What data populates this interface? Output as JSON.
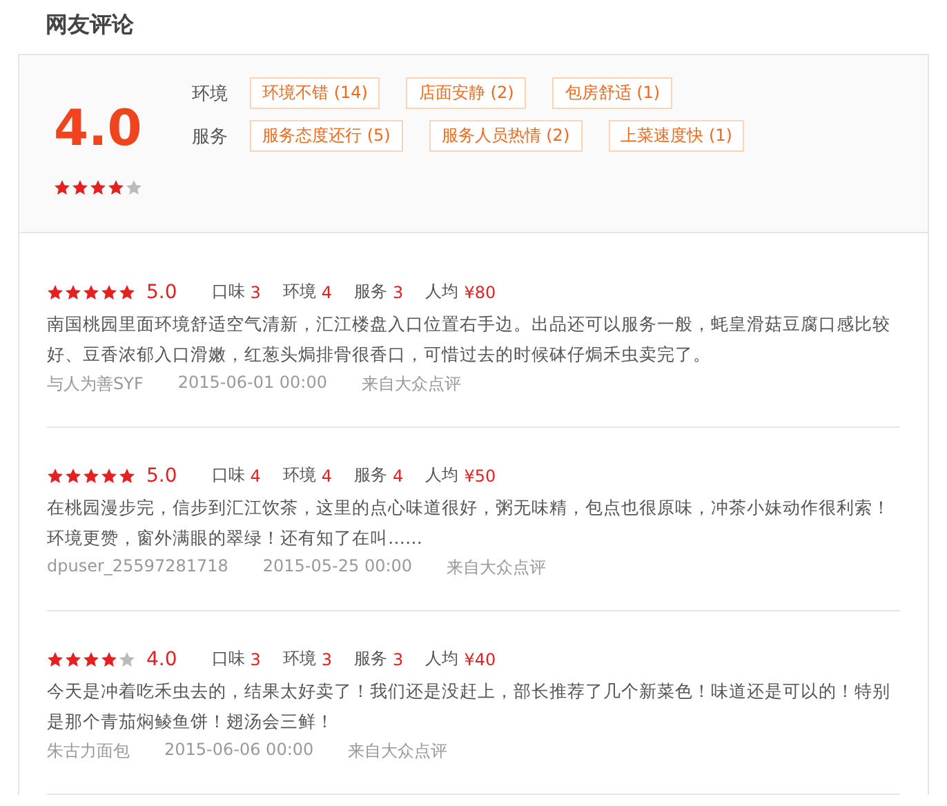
{
  "title": "网友评论",
  "summary": {
    "score": "4.0",
    "stars": 4,
    "tag_groups": [
      {
        "label": "环境",
        "tags": [
          "环境不错 (14)",
          "店面安静 (2)",
          "包房舒适 (1)"
        ]
      },
      {
        "label": "服务",
        "tags": [
          "服务态度还行 (5)",
          "服务人员热情 (2)",
          "上菜速度快 (1)"
        ]
      }
    ]
  },
  "reviews": [
    {
      "stars": 5,
      "score": "5.0",
      "ratings": [
        {
          "label": "口味",
          "value": "3"
        },
        {
          "label": "环境",
          "value": "4"
        },
        {
          "label": "服务",
          "value": "3"
        },
        {
          "label": "人均",
          "value": "¥80"
        }
      ],
      "text": "南国桃园里面环境舒适空气清新，汇江楼盘入口位置右手边。出品还可以服务一般，蚝皇滑菇豆腐口感比较好、豆香浓郁入口滑嫩，红葱头焗排骨很香口，可惜过去的时候砵仔焗禾虫卖完了。",
      "user": "与人为善SYF",
      "date": "2015-06-01 00:00",
      "source": "来自大众点评"
    },
    {
      "stars": 5,
      "score": "5.0",
      "ratings": [
        {
          "label": "口味",
          "value": "4"
        },
        {
          "label": "环境",
          "value": "4"
        },
        {
          "label": "服务",
          "value": "4"
        },
        {
          "label": "人均",
          "value": "¥50"
        }
      ],
      "text": "在桃园漫步完，信步到汇江饮茶，这里的点心味道很好，粥无味精，包点也很原味，冲茶小妹动作很利索！环境更赞，窗外满眼的翠绿！还有知了在叫……",
      "user": "dpuser_25597281718",
      "date": "2015-05-25 00:00",
      "source": "来自大众点评"
    },
    {
      "stars": 4,
      "score": "4.0",
      "ratings": [
        {
          "label": "口味",
          "value": "3"
        },
        {
          "label": "环境",
          "value": "3"
        },
        {
          "label": "服务",
          "value": "3"
        },
        {
          "label": "人均",
          "value": "¥40"
        }
      ],
      "text": "今天是冲着吃禾虫去的，结果太好卖了！我们还是没赶上，部长推荐了几个新菜色！味道还是可以的！特别是那个青茄焖鲮鱼饼！翅汤会三鲜！",
      "user": "朱古力面包",
      "date": "2015-06-06 00:00",
      "source": "来自大众点评"
    }
  ]
}
